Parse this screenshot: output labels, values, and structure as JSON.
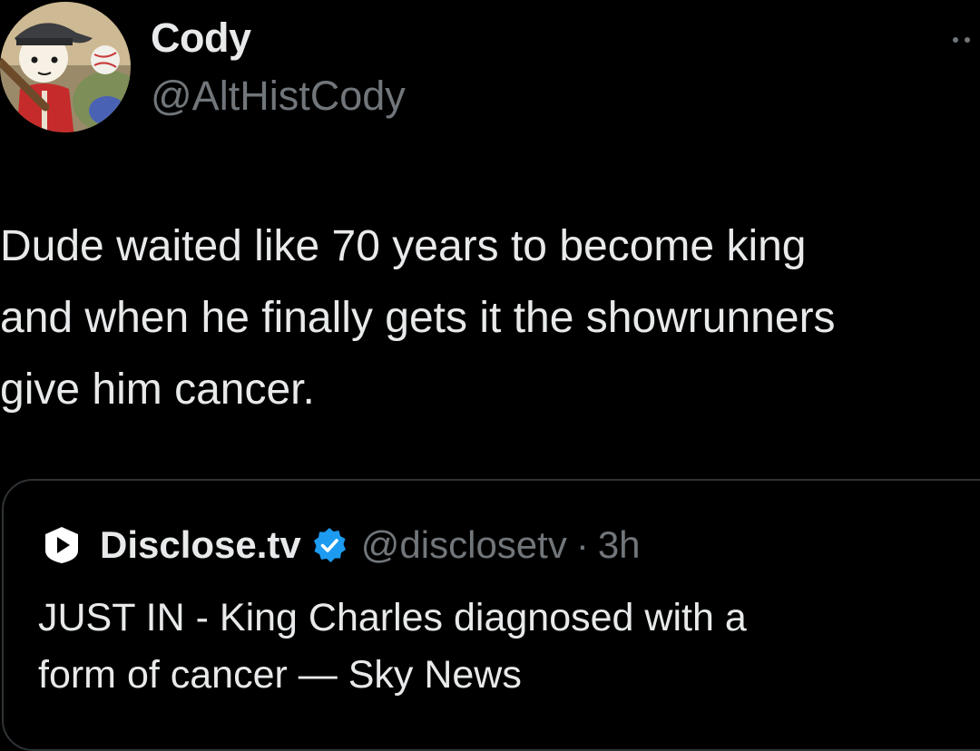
{
  "author": {
    "display_name": "Cody",
    "handle": "@AltHistCody",
    "avatar_icon": "cartoon-baseball-player-avatar"
  },
  "tweet": {
    "text": "Dude waited like 70 years to become king\nand when he finally gets it the showrunners\ngive him cancer."
  },
  "quoted_tweet": {
    "display_name": "Disclose.tv",
    "handle": "@disclosetv",
    "separator": "·",
    "time": "3h",
    "logo_icon": "disclose-tv-logo-icon",
    "verified_icon": "verified-badge-icon",
    "text": "JUST IN - King Charles diagnosed with a\nform of cancer — Sky News"
  },
  "colors": {
    "background": "#000000",
    "primary_text": "#e7e9ea",
    "secondary_text": "#71767b",
    "border": "#2f3336",
    "verified": "#1d9bf0"
  },
  "icons": {
    "more": "more-options-icon"
  }
}
